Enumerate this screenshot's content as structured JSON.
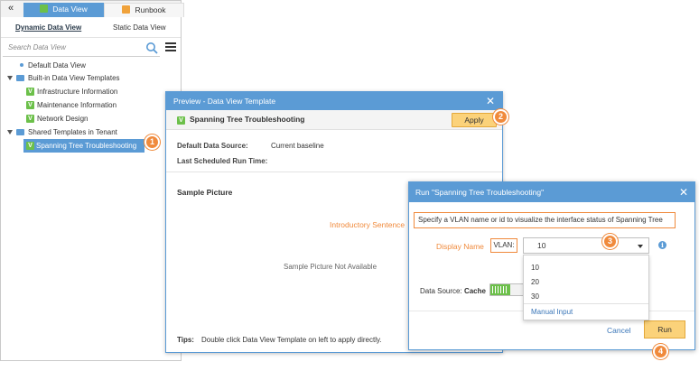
{
  "left_panel": {
    "collapse_glyph": "«",
    "tabs": [
      {
        "label": "Data View",
        "icon": "data-view-icon",
        "active": true
      },
      {
        "label": "Runbook",
        "icon": "runbook-icon",
        "active": false
      }
    ],
    "subtabs": {
      "dynamic": "Dynamic Data View",
      "static": "Static Data View"
    },
    "search": {
      "placeholder": "Search Data View",
      "value": ""
    },
    "tree": {
      "default_item": "Default Data View",
      "builtin_folder": "Built-in Data View Templates",
      "builtin_items": [
        "Infrastructure Information",
        "Maintenance Information",
        "Network Design"
      ],
      "shared_folder": "Shared Templates in Tenant",
      "shared_items": [
        "Spanning Tree Troubleshooting"
      ]
    }
  },
  "callouts": [
    "1",
    "2",
    "3",
    "4"
  ],
  "preview": {
    "title": "Preview - Data View Template",
    "template_name": "Spanning Tree Troubleshooting",
    "apply_label": "Apply",
    "default_source_label": "Default Data Source:",
    "default_source_value": "Current baseline",
    "last_run_label": "Last Scheduled Run Time:",
    "last_run_value": "",
    "sample_picture_title": "Sample Picture",
    "introductory_label": "Introductory Sentence",
    "sample_not_available": "Sample Picture Not Available",
    "tips_label": "Tips:",
    "tips_text": "Double click Data View Template on left to apply directly."
  },
  "run_dialog": {
    "title": "Run \"Spanning Tree Troubleshooting\"",
    "intro_sentence": "Specify a VLAN name or id to visualize the interface status of Spanning Tree",
    "display_name_label": "Display Name",
    "vlan_label": "VLAN:",
    "vlan_value": "10",
    "vlan_options": [
      "10",
      "20",
      "30"
    ],
    "manual_input_label": "Manual Input",
    "data_source_label": "Data Source:",
    "data_source_value": "Cache",
    "cancel_label": "Cancel",
    "run_label": "Run"
  },
  "colors": {
    "accent": "#5b9bd5",
    "callout": "#f08a3c",
    "button": "#fbd27a",
    "template_icon": "#6cc04a"
  }
}
